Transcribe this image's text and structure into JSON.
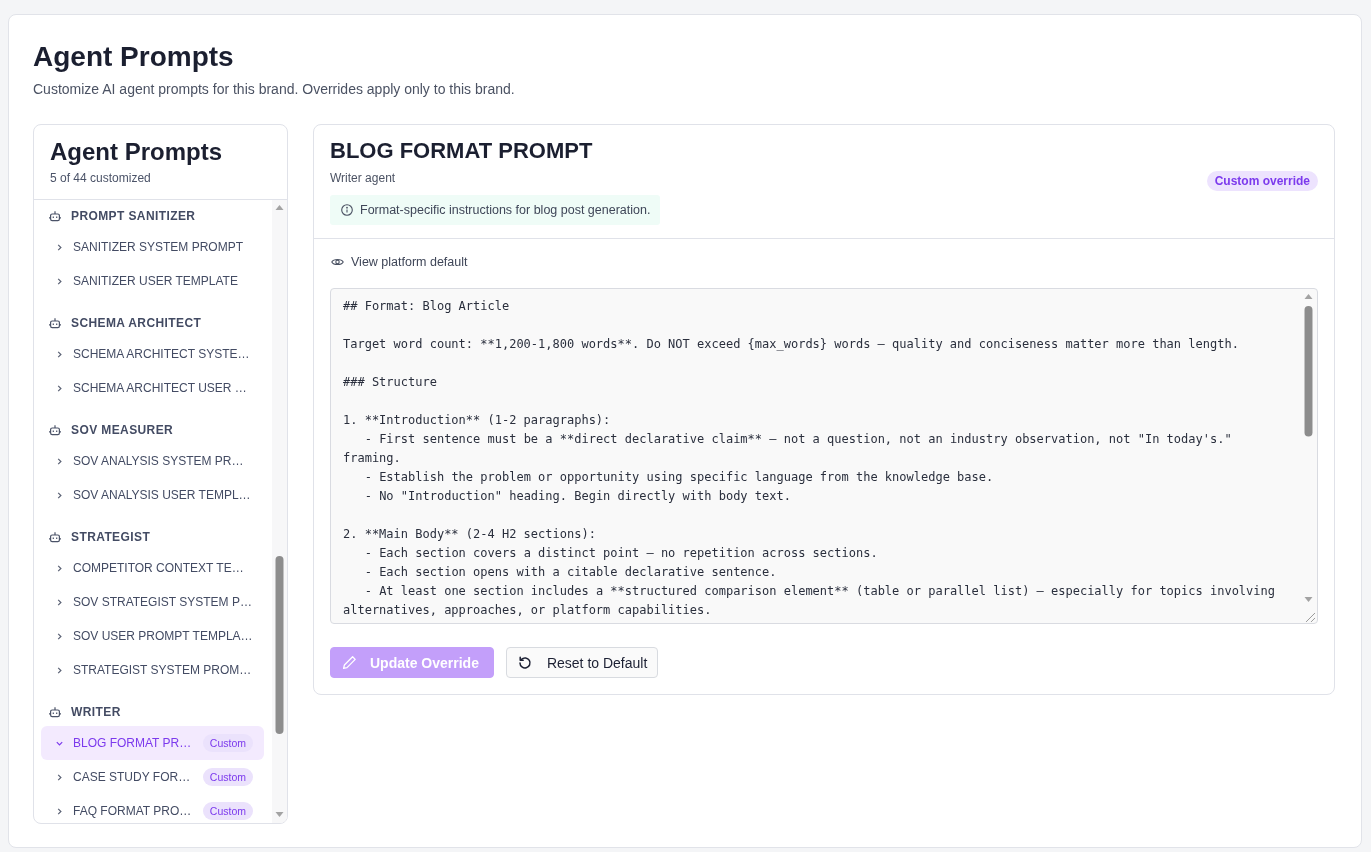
{
  "page": {
    "title": "Agent Prompts",
    "subtitle": "Customize AI agent prompts for this brand. Overrides apply only to this brand."
  },
  "sidebar": {
    "title": "Agent Prompts",
    "count": "5 of 44 customized",
    "groups": [
      {
        "name": "PROMPT SANITIZER",
        "items": [
          {
            "label": "SANITIZER SYSTEM PROMPT",
            "selected": false,
            "expanded": false
          },
          {
            "label": "SANITIZER USER TEMPLATE",
            "selected": false,
            "expanded": false
          }
        ]
      },
      {
        "name": "SCHEMA ARCHITECT",
        "items": [
          {
            "label": "SCHEMA ARCHITECT SYSTE…",
            "selected": false,
            "expanded": false
          },
          {
            "label": "SCHEMA ARCHITECT USER …",
            "selected": false,
            "expanded": false
          }
        ]
      },
      {
        "name": "SOV MEASURER",
        "items": [
          {
            "label": "SOV ANALYSIS SYSTEM PR…",
            "selected": false,
            "expanded": false
          },
          {
            "label": "SOV ANALYSIS USER TEMPL…",
            "selected": false,
            "expanded": false
          }
        ]
      },
      {
        "name": "STRATEGIST",
        "items": [
          {
            "label": "COMPETITOR CONTEXT TE…",
            "selected": false,
            "expanded": false
          },
          {
            "label": "SOV STRATEGIST SYSTEM P…",
            "selected": false,
            "expanded": false
          },
          {
            "label": "SOV USER PROMPT TEMPLA…",
            "selected": false,
            "expanded": false
          },
          {
            "label": "STRATEGIST SYSTEM PROM…",
            "selected": false,
            "expanded": false
          }
        ]
      },
      {
        "name": "WRITER",
        "items": [
          {
            "label": "BLOG FORMAT PR…",
            "badge": "Custom",
            "selected": true,
            "expanded": true
          },
          {
            "label": "CASE STUDY FOR…",
            "badge": "Custom",
            "selected": false,
            "expanded": false
          },
          {
            "label": "FAQ FORMAT PRO…",
            "badge": "Custom",
            "selected": false,
            "expanded": false
          }
        ]
      }
    ]
  },
  "detail": {
    "title": "BLOG FORMAT PROMPT",
    "agent": "Writer agent",
    "badge": "Custom override",
    "info": "Format-specific instructions for blog post generation.",
    "default_link": "View platform default",
    "editor": {
      "value": "## Format: Blog Article\n\nTarget word count: **1,200-1,800 words**. Do NOT exceed {max_words} words — quality and conciseness matter more than length.\n\n### Structure\n\n1. **Introduction** (1-2 paragraphs):\n   - First sentence must be a **direct declarative claim** — not a question, not an industry observation, not \"In today's.\" framing.\n   - Establish the problem or opportunity using specific language from the knowledge base.\n   - No \"Introduction\" heading. Begin directly with body text.\n\n2. **Main Body** (2-4 H2 sections):\n   - Each section covers a distinct point — no repetition across sections.\n   - Each section opens with a citable declarative sentence.\n   - At least one section includes a **structured comparison element** (table or parallel list) — especially for topics involving alternatives, approaches, or platform capabilities."
    },
    "buttons": [
      {
        "label": "Update Override",
        "kind": "primary",
        "disabled": true
      },
      {
        "label": "Reset to Default",
        "kind": "secondary",
        "disabled": false
      }
    ]
  }
}
